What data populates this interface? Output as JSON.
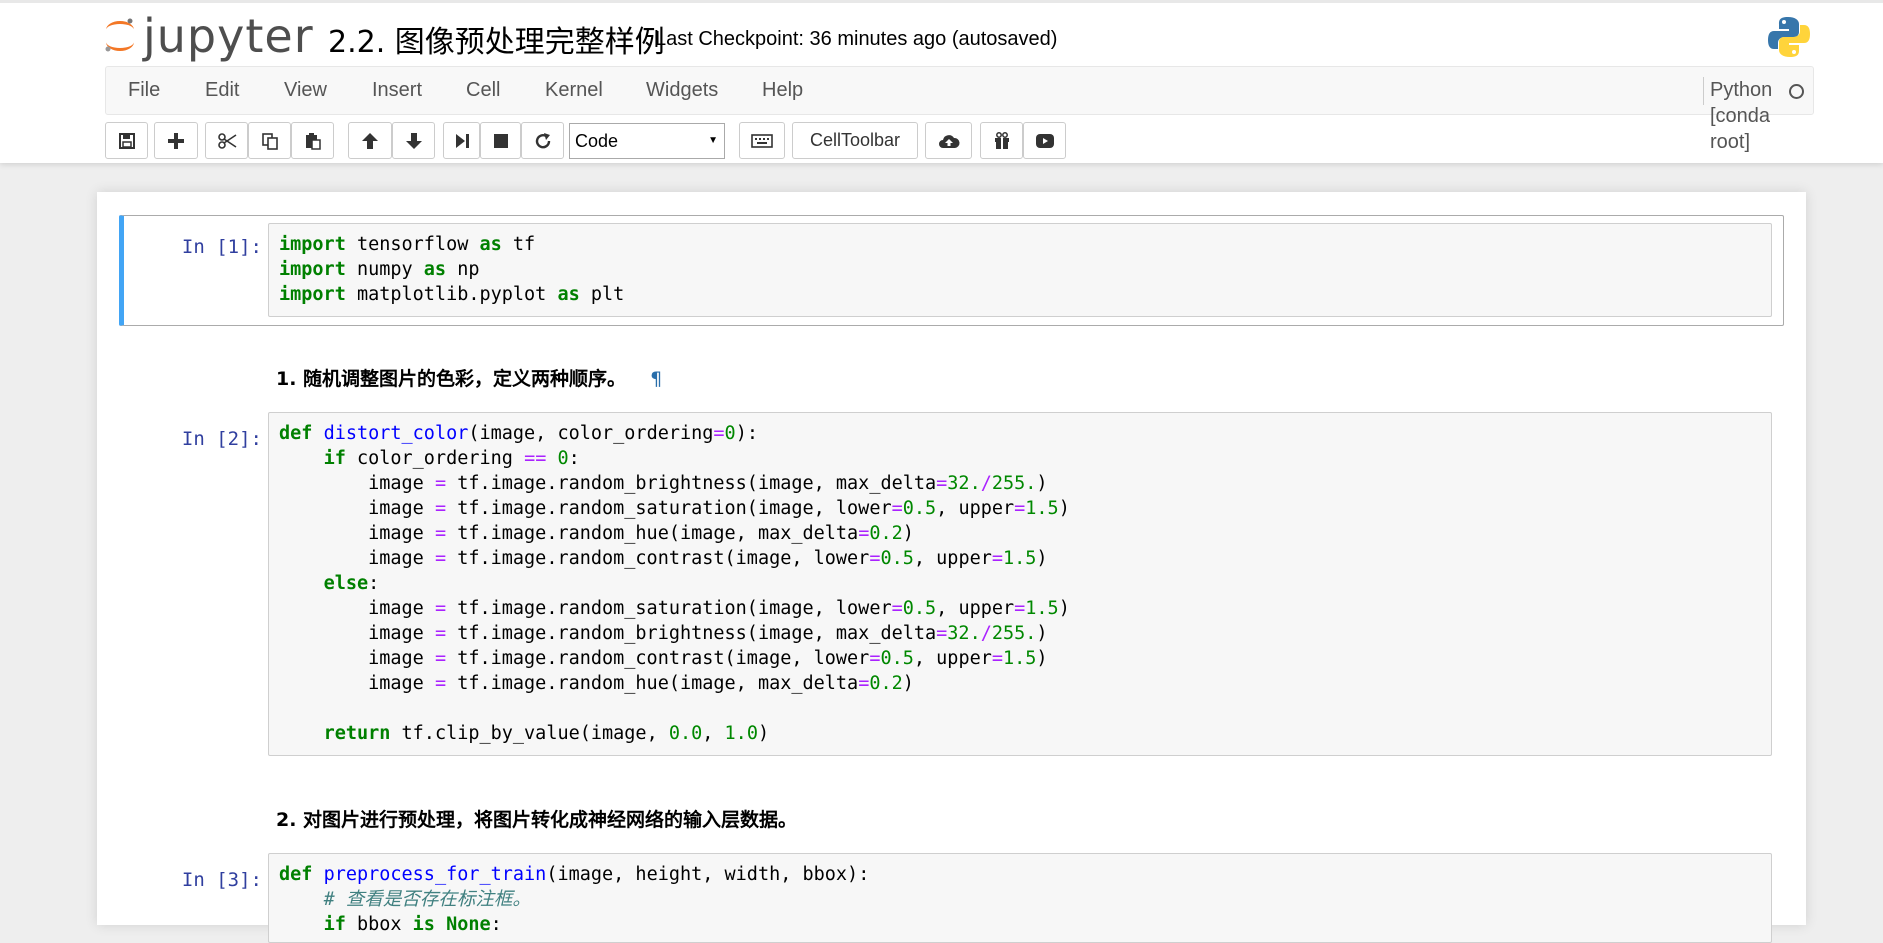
{
  "header": {
    "logo_text": "jupyter",
    "notebook_title": "2.2. 图像预处理完整样例",
    "checkpoint": "Last Checkpoint: 36 minutes ago (autosaved)"
  },
  "menu": {
    "items": [
      "File",
      "Edit",
      "View",
      "Insert",
      "Cell",
      "Kernel",
      "Widgets",
      "Help"
    ],
    "kernel_name": "Python [conda root]"
  },
  "toolbar": {
    "cell_type": "Code",
    "celltoolbar_label": "CellToolbar",
    "icons": [
      "save-icon",
      "plus-icon",
      "cut-icon",
      "copy-icon",
      "paste-icon",
      "arrow-up-icon",
      "arrow-down-icon",
      "step-forward-icon",
      "stop-icon",
      "restart-icon",
      "keyboard-icon",
      "cloud-upload-icon",
      "gift-icon",
      "youtube-icon"
    ]
  },
  "cells": {
    "c1": {
      "prompt": "In [1]:",
      "lines": [
        "import tensorflow as tf",
        "import numpy as np",
        "import matplotlib.pyplot as plt"
      ]
    },
    "md1": {
      "text": "1. 随机调整图片的色彩，定义两种顺序。",
      "anchor": "¶"
    },
    "c2": {
      "prompt": "In [2]:",
      "lines": [
        "def distort_color(image, color_ordering=0):",
        "    if color_ordering == 0:",
        "        image = tf.image.random_brightness(image, max_delta=32./255.)",
        "        image = tf.image.random_saturation(image, lower=0.5, upper=1.5)",
        "        image = tf.image.random_hue(image, max_delta=0.2)",
        "        image = tf.image.random_contrast(image, lower=0.5, upper=1.5)",
        "    else:",
        "        image = tf.image.random_saturation(image, lower=0.5, upper=1.5)",
        "        image = tf.image.random_brightness(image, max_delta=32./255.)",
        "        image = tf.image.random_contrast(image, lower=0.5, upper=1.5)",
        "        image = tf.image.random_hue(image, max_delta=0.2)",
        "",
        "    return tf.clip_by_value(image, 0.0, 1.0)"
      ]
    },
    "md2": {
      "text": "2. 对图片进行预处理，将图片转化成神经网络的输入层数据。"
    },
    "c3": {
      "prompt": "In [3]:",
      "lines": [
        "def preprocess_for_train(image, height, width, bbox):",
        "    # 查看是否存在标注框。",
        "    if bbox is None:"
      ]
    }
  }
}
